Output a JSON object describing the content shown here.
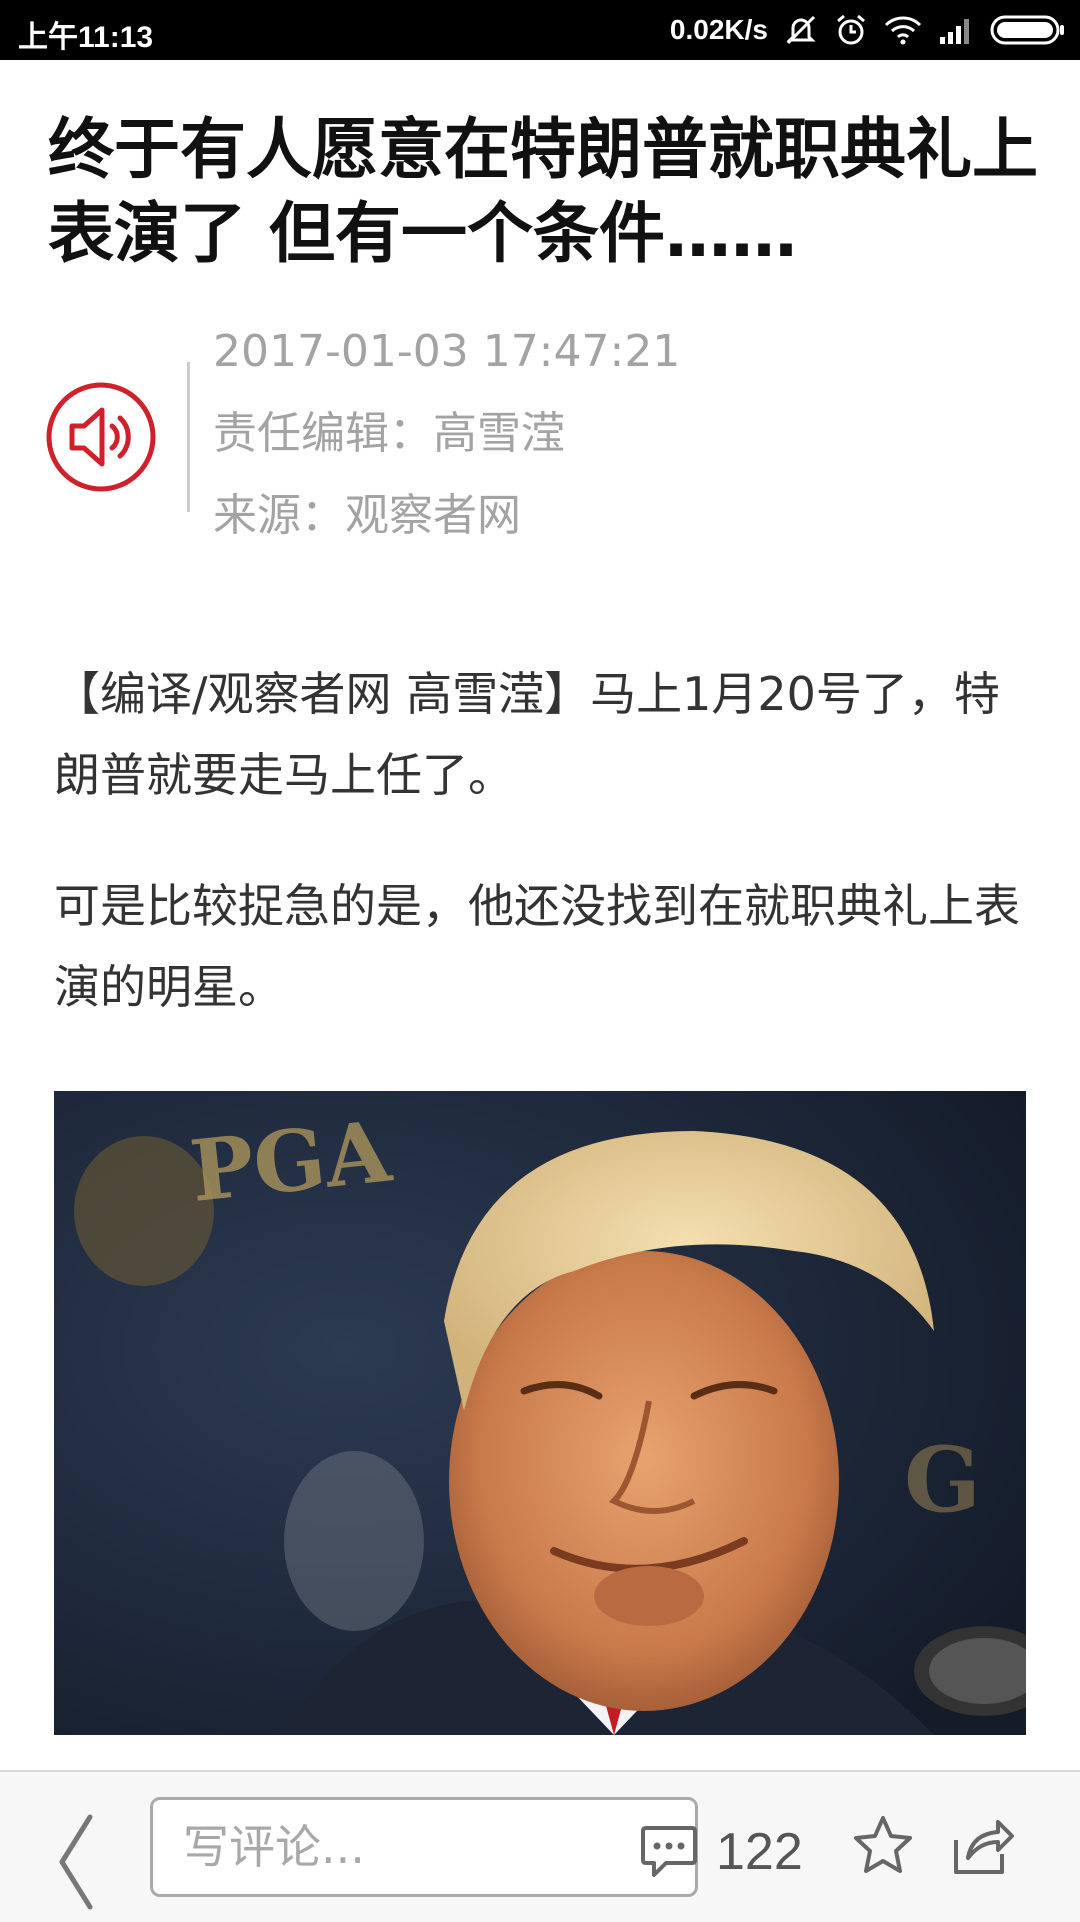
{
  "status_bar": {
    "time": "上午11:13",
    "net_speed": "0.02K/s",
    "icons": [
      "mute-icon",
      "alarm-icon",
      "wifi-icon",
      "signal-icon",
      "battery-icon"
    ]
  },
  "article": {
    "title": "终于有人愿意在特朗普就职典礼上表演了 但有一个条件……",
    "date": "2017-01-03 17:47:21",
    "editor": "责任编辑：高雪滢",
    "source": "来源：观察者网",
    "paragraphs": [
      "【编译/观察者网 高雪滢】马上1月20号了，特朗普就要走马上任了。",
      "可是比较捉急的是，他还没找到在就职典礼上表演的明星。"
    ],
    "image_backdrop_text": "PGA"
  },
  "bottom_bar": {
    "comment_placeholder": "写评论...",
    "comment_count": "122"
  },
  "colors": {
    "accent_red": "#d0202a",
    "meta_gray": "#a3a3a3",
    "status_bg": "#000000"
  }
}
